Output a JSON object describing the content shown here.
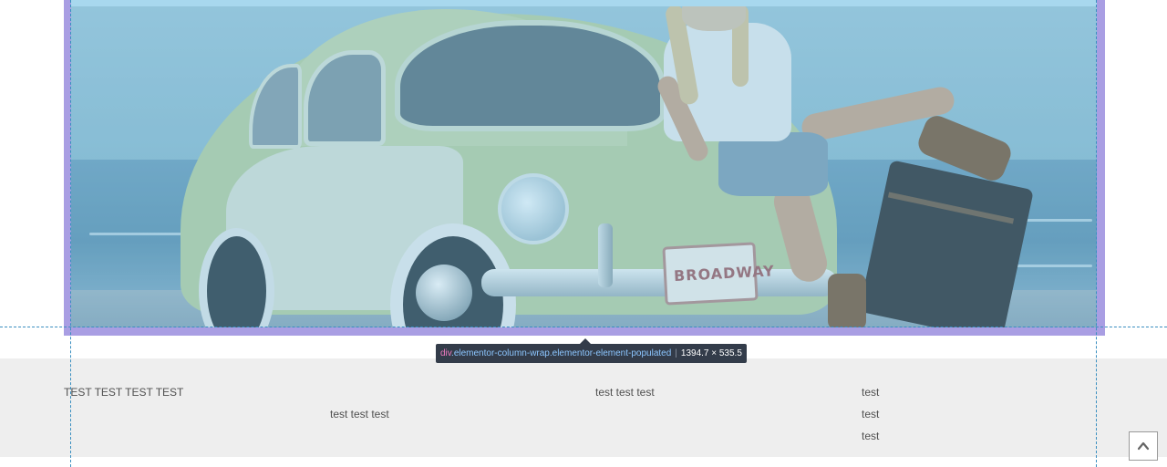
{
  "tooltip": {
    "tag": "div",
    "classes": ".elementor-column-wrap.elementor-element-populated",
    "dimensions": "1394.7 × 535.5"
  },
  "image": {
    "plate_text": "BROADWAY",
    "description_icon": "car-photo"
  },
  "section": {
    "heading": "TEST TEST TEST TEST",
    "col2_text": "test test test",
    "col3_text": "test test test",
    "col4_items": [
      "test",
      "test",
      "test"
    ]
  },
  "scroll_top": {
    "icon": "chevron-up-icon"
  },
  "colors": {
    "highlight": "#a99ee3",
    "guide": "#3a8fc0",
    "tooltip_bg": "#333c4a",
    "section_bg": "#eeeeee"
  }
}
